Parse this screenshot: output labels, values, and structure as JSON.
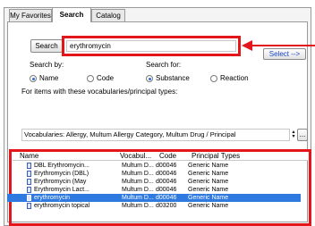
{
  "tabs": [
    {
      "label": "My Favorites"
    },
    {
      "label": "Search"
    },
    {
      "label": "Catalog"
    }
  ],
  "search": {
    "button_label": "Search",
    "value": "erythromycin",
    "select_label": "Select -->"
  },
  "search_by": {
    "label": "Search by:",
    "options": [
      "Name",
      "Code"
    ],
    "selected": "Name"
  },
  "search_for": {
    "label": "Search for:",
    "options": [
      "Substance",
      "Reaction"
    ],
    "selected": "Substance"
  },
  "filter": {
    "label": "For items with these vocabularies/principal types:",
    "vocab_text": "Vocabularies: Allergy, Multum Allergy Category, Multum Drug / Principal",
    "more_label": "..."
  },
  "results": {
    "columns": [
      "Name",
      "Vocabul...",
      "Code",
      "Principal Types"
    ],
    "rows": [
      {
        "name": "DBL Erythromycin...",
        "vocab": "Multum D...",
        "code": "d00046",
        "type": "Generic Name"
      },
      {
        "name": "Erythromycin (DBL)",
        "vocab": "Multum D...",
        "code": "d00046",
        "type": "Generic Name"
      },
      {
        "name": "Erythromycin (May",
        "vocab": "Multum D...",
        "code": "d00046",
        "type": "Generic Name"
      },
      {
        "name": "Erythromycin Lact...",
        "vocab": "Multum D...",
        "code": "d00046",
        "type": "Generic Name"
      },
      {
        "name": "erythromycin",
        "vocab": "Multum D...",
        "code": "d00046",
        "type": "Generic Name"
      },
      {
        "name": "erythromycin topical",
        "vocab": "Multum D...",
        "code": "d03200",
        "type": "Generic Name"
      }
    ],
    "selected_index": 4
  },
  "colors": {
    "highlight": "#e3161b",
    "selection": "#2f7ae0",
    "arrow": "#e3161b"
  }
}
